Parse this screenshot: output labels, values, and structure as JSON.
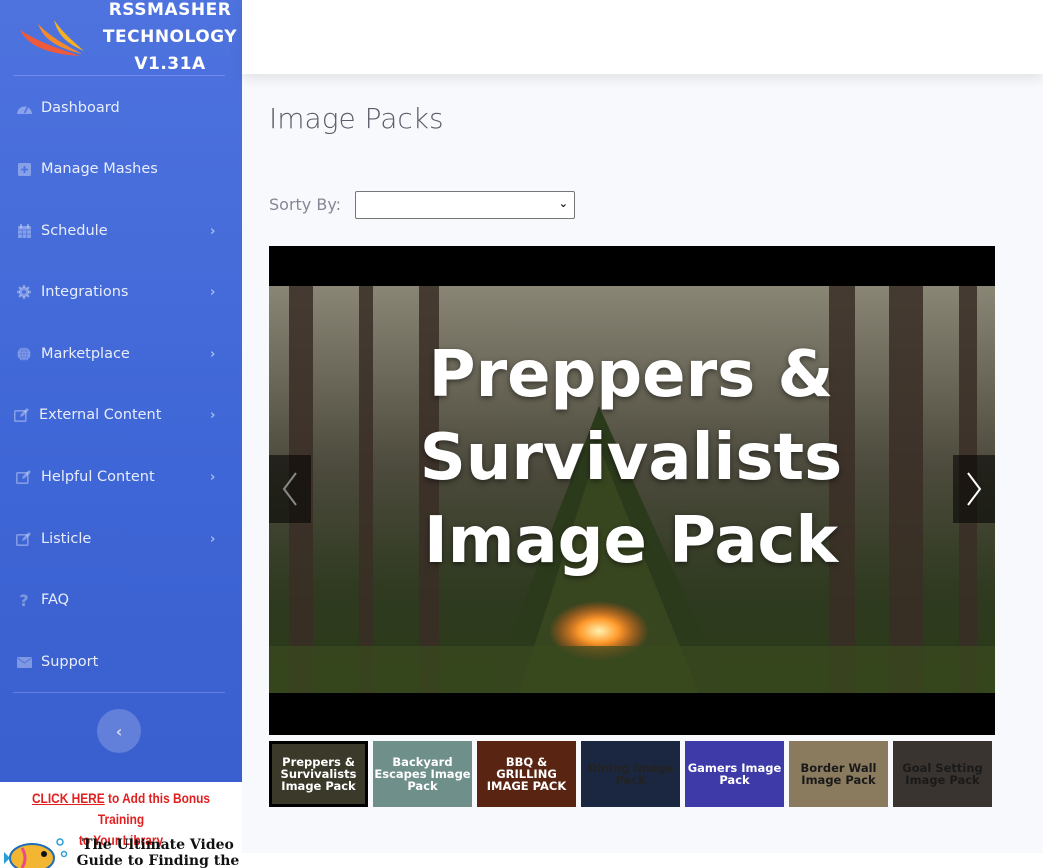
{
  "brand": {
    "line1": "RSSMASHER",
    "line2": "TECHNOLOGY",
    "line3": "V1.31A"
  },
  "sidebar": {
    "items": [
      {
        "label": "Dashboard",
        "icon": "tachometer-icon",
        "has_children": false
      },
      {
        "label": "Manage Mashes",
        "icon": "plus-square-icon",
        "has_children": false
      },
      {
        "label": "Schedule",
        "icon": "calendar-icon",
        "has_children": true
      },
      {
        "label": "Integrations",
        "icon": "gear-icon",
        "has_children": true
      },
      {
        "label": "Marketplace",
        "icon": "globe-icon",
        "has_children": true
      },
      {
        "label": "External Content",
        "icon": "edit-icon",
        "has_children": true
      },
      {
        "label": "Helpful Content",
        "icon": "edit-icon",
        "has_children": true
      },
      {
        "label": "Listicle",
        "icon": "edit-icon",
        "has_children": true
      },
      {
        "label": "FAQ",
        "icon": "question-icon",
        "has_children": false
      },
      {
        "label": "Support",
        "icon": "envelope-icon",
        "has_children": false
      }
    ],
    "toggle_glyph": "‹"
  },
  "promo": {
    "click_here": "CLICK HERE",
    "line1_rest": " to Add this Bonus Training",
    "line2": "to Your Library",
    "title": "The Ultimate Video Guide to Finding the"
  },
  "main": {
    "title": "Image Packs",
    "sort_label": "Sorty By:",
    "sort_value": ""
  },
  "carousel": {
    "caption_lines": [
      "Preppers &",
      "Survivalists",
      "Image Pack"
    ],
    "prev_glyph": "‹",
    "next_glyph": "›"
  },
  "thumbnails": [
    {
      "label": "Preppers & Survivalists Image Pack",
      "active": true,
      "bg": "#3b3a2a",
      "color": "#ffffff"
    },
    {
      "label": "Backyard Escapes Image Pack",
      "active": false,
      "bg": "#6f8f8a",
      "color": "#ffffff"
    },
    {
      "label": "BBQ & GRILLING IMAGE PACK",
      "active": false,
      "bg": "#5a2412",
      "color": "#ffffff"
    },
    {
      "label": "Dining Image Pack",
      "active": false,
      "bg": "#1b2740",
      "color": "#222222"
    },
    {
      "label": "Gamers Image Pack",
      "active": false,
      "bg": "#3e3aa8",
      "color": "#ffffff"
    },
    {
      "label": "Border Wall Image Pack",
      "active": false,
      "bg": "#8a7a5e",
      "color": "#1a1a1a"
    },
    {
      "label": "Goal Setting Image Pack",
      "active": false,
      "bg": "#3a3430",
      "color": "#1a1a1a"
    }
  ]
}
